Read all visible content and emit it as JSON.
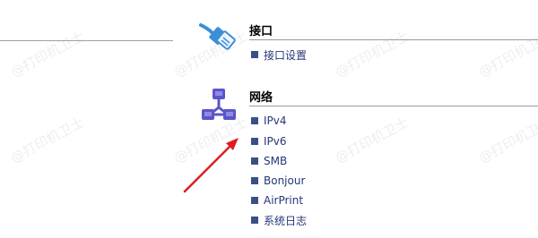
{
  "watermark_text": "@打印机卫士",
  "interface_section": {
    "title": "接口",
    "icon": "network-cable-icon",
    "items": [
      {
        "label": "接口设置"
      }
    ]
  },
  "network_section": {
    "title": "网络",
    "icon": "network-topology-icon",
    "items": [
      {
        "label": "IPv4"
      },
      {
        "label": "IPv6"
      },
      {
        "label": "SMB"
      },
      {
        "label": "Bonjour"
      },
      {
        "label": "AirPrint"
      },
      {
        "label": "系统日志"
      }
    ]
  },
  "colors": {
    "link": "#24367a",
    "bullet": "#3a4f84",
    "icon_blue": "#3b8fd6",
    "icon_purple": "#5b55c8",
    "arrow": "#e01b1b"
  }
}
